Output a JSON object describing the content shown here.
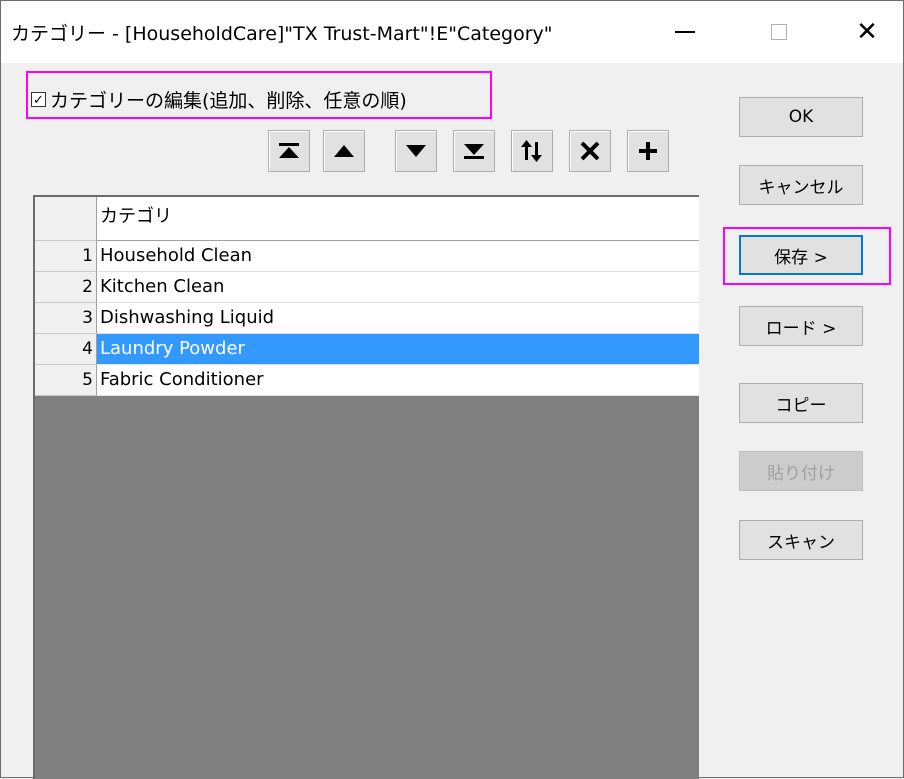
{
  "window": {
    "title": "カテゴリー - [HouseholdCare]\"TX Trust-Mart\"!E\"Category\"",
    "minimize_label": "—",
    "close_label": "✕"
  },
  "edit_checkbox": {
    "checked": true,
    "label": "カテゴリーの編集(追加、削除、任意の順)"
  },
  "toolbar": [
    {
      "name": "move-to-top-icon"
    },
    {
      "name": "move-up-icon"
    },
    {
      "name": "move-down-icon"
    },
    {
      "name": "move-to-bottom-icon"
    },
    {
      "name": "reverse-order-icon"
    },
    {
      "name": "delete-icon"
    },
    {
      "name": "add-icon"
    }
  ],
  "table": {
    "column_header": "カテゴリ",
    "rows": [
      {
        "num": "1",
        "value": "Household Clean"
      },
      {
        "num": "2",
        "value": "Kitchen Clean"
      },
      {
        "num": "3",
        "value": "Dishwashing Liquid"
      },
      {
        "num": "4",
        "value": "Laundry Powder",
        "selected": true
      },
      {
        "num": "5",
        "value": "Fabric Conditioner"
      }
    ]
  },
  "buttons": {
    "ok": "OK",
    "cancel": "キャンセル",
    "save": "保存 >",
    "load": "ロード >",
    "copy": "コピー",
    "paste": "貼り付け",
    "scan": "スキャン"
  },
  "colors": {
    "highlight_box": "#ff00ff",
    "selection": "#3399ff",
    "grid_background": "#808080"
  }
}
